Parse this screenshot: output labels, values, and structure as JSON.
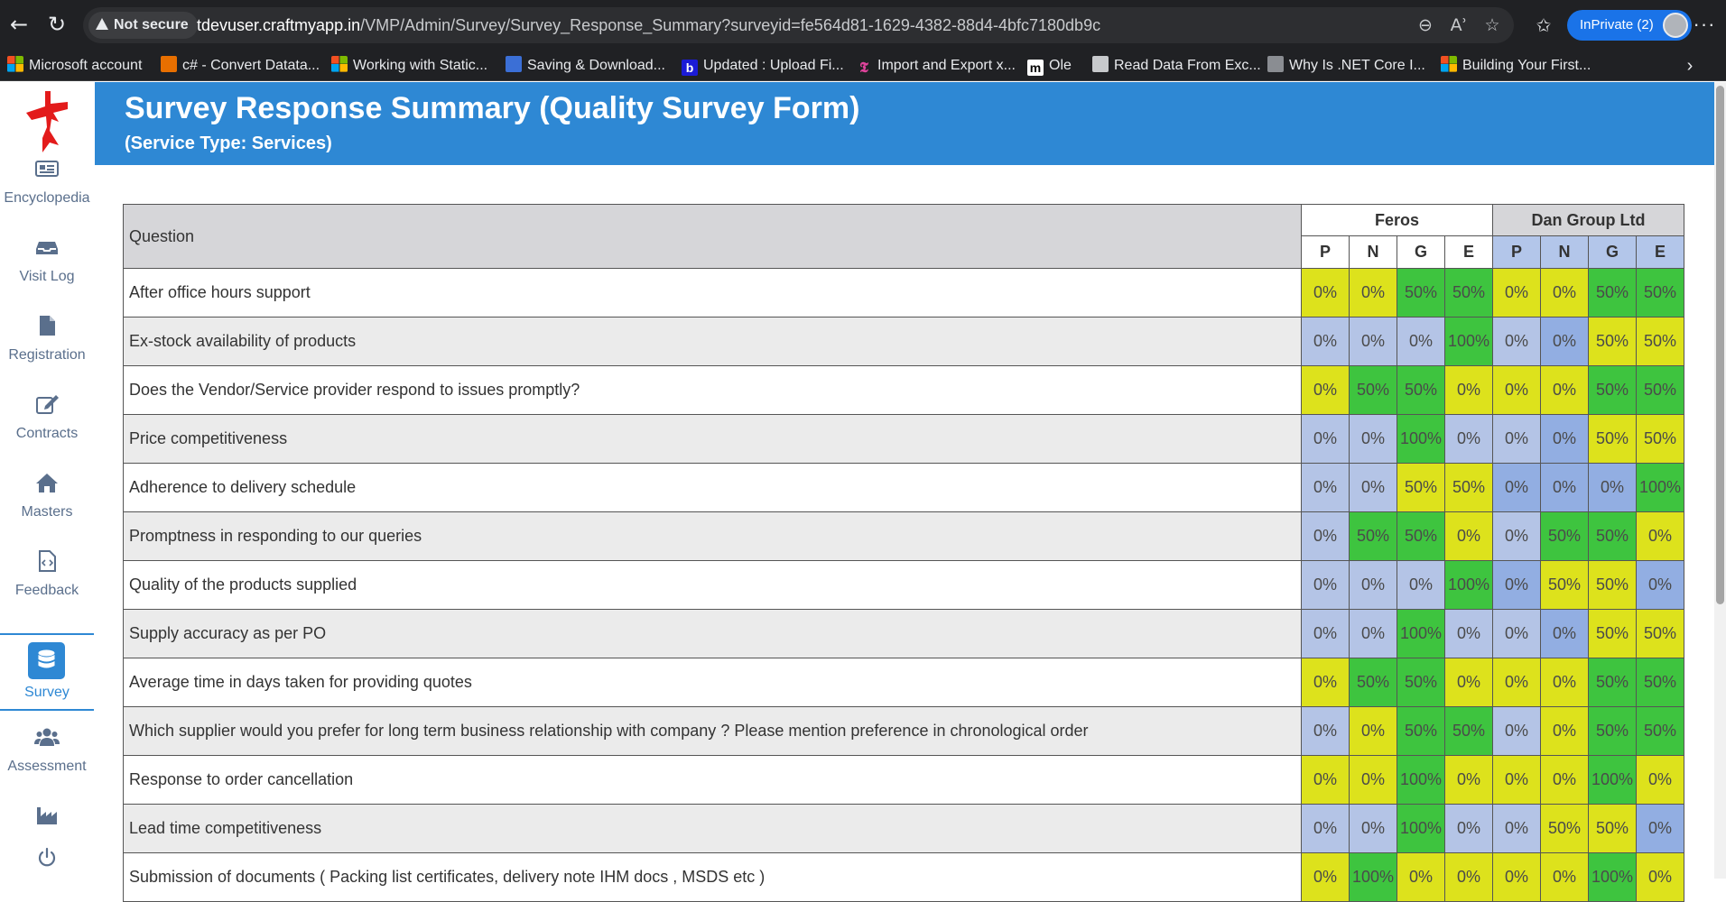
{
  "browser": {
    "not_secure": "Not secure",
    "url_host": "tdevuser.craftmyapp.in",
    "url_path": "/VMP/Admin/Survey/Survey_Response_Summary?surveyid=fe564d81-1629-4382-88d4-4bfc7180db9c",
    "inprivate_label": "InPrivate (2)",
    "bookmarks": [
      {
        "label": "Microsoft account",
        "icon": "microsoft-icon"
      },
      {
        "label": "c# - Convert Datata...",
        "icon": "java-icon"
      },
      {
        "label": "Working with Static...",
        "icon": "microsoft-icon"
      },
      {
        "label": "Saving & Download...",
        "icon": "hd-icon"
      },
      {
        "label": "Updated : Upload Fi...",
        "icon": "b-icon"
      },
      {
        "label": "Import and Export x...",
        "icon": "tb-icon"
      },
      {
        "label": "Ole",
        "icon": "m-icon"
      },
      {
        "label": "Read Data From Exc...",
        "icon": "figure-icon"
      },
      {
        "label": "Why Is .NET Core I...",
        "icon": "net-icon"
      },
      {
        "label": "Building Your First...",
        "icon": "microsoft-icon"
      }
    ]
  },
  "sidebar": {
    "items": [
      {
        "label": "Encyclopedia",
        "icon": "newspaper-icon",
        "active": false
      },
      {
        "label": "Visit Log",
        "icon": "inbox-icon",
        "active": false
      },
      {
        "label": "Registration",
        "icon": "file-icon",
        "active": false
      },
      {
        "label": "Contracts",
        "icon": "edit-icon",
        "active": false
      },
      {
        "label": "Masters",
        "icon": "home-icon",
        "active": false
      },
      {
        "label": "Feedback",
        "icon": "file-code-icon",
        "active": false
      },
      {
        "label": "Survey",
        "icon": "database-icon",
        "active": true
      },
      {
        "label": "Assessment",
        "icon": "users-icon",
        "active": false
      },
      {
        "label": "",
        "icon": "industry-icon",
        "active": false
      }
    ],
    "power_icon": "power-icon"
  },
  "header": {
    "title": "Survey Response Summary (Quality Survey Form)",
    "subtitle": "(Service Type: Services)"
  },
  "colors": {
    "accent": "#2e88d4",
    "P_or_zero_yellow": "#dde21c",
    "green": "#3ec43f",
    "light_blue": "#b4c4e6",
    "mid_blue": "#92aee2"
  },
  "table": {
    "question_header": "Question",
    "vendors": [
      "Feros",
      "Dan Group Ltd"
    ],
    "ratings": [
      "P",
      "N",
      "G",
      "E"
    ],
    "rows": [
      {
        "question": "After office hours support",
        "values": [
          "0%",
          "0%",
          "50%",
          "50%",
          "0%",
          "0%",
          "50%",
          "50%"
        ],
        "colors": [
          "y",
          "y",
          "g",
          "g",
          "y",
          "y",
          "g",
          "g"
        ]
      },
      {
        "question": "Ex-stock availability of products",
        "values": [
          "0%",
          "0%",
          "0%",
          "100%",
          "0%",
          "0%",
          "50%",
          "50%"
        ],
        "colors": [
          "lb",
          "lb",
          "lb",
          "g",
          "lb",
          "mb",
          "y",
          "y"
        ]
      },
      {
        "question": "Does the Vendor/Service provider respond to issues promptly?",
        "values": [
          "0%",
          "50%",
          "50%",
          "0%",
          "0%",
          "0%",
          "50%",
          "50%"
        ],
        "colors": [
          "y",
          "g",
          "g",
          "y",
          "y",
          "y",
          "g",
          "g"
        ]
      },
      {
        "question": "Price competitiveness",
        "values": [
          "0%",
          "0%",
          "100%",
          "0%",
          "0%",
          "0%",
          "50%",
          "50%"
        ],
        "colors": [
          "lb",
          "lb",
          "g",
          "lb",
          "lb",
          "mb",
          "y",
          "y"
        ]
      },
      {
        "question": "Adherence to delivery schedule",
        "values": [
          "0%",
          "0%",
          "50%",
          "50%",
          "0%",
          "0%",
          "0%",
          "100%"
        ],
        "colors": [
          "lb",
          "lb",
          "y",
          "y",
          "mb",
          "mb",
          "mb",
          "g"
        ]
      },
      {
        "question": "Promptness in responding to our queries",
        "values": [
          "0%",
          "50%",
          "50%",
          "0%",
          "0%",
          "50%",
          "50%",
          "0%"
        ],
        "colors": [
          "lb",
          "g",
          "g",
          "y",
          "lb",
          "g",
          "g",
          "y"
        ]
      },
      {
        "question": "Quality of the products supplied",
        "values": [
          "0%",
          "0%",
          "0%",
          "100%",
          "0%",
          "50%",
          "50%",
          "0%"
        ],
        "colors": [
          "lb",
          "lb",
          "lb",
          "g",
          "mb",
          "y",
          "y",
          "mb"
        ]
      },
      {
        "question": "Supply accuracy as per PO",
        "values": [
          "0%",
          "0%",
          "100%",
          "0%",
          "0%",
          "0%",
          "50%",
          "50%"
        ],
        "colors": [
          "lb",
          "lb",
          "g",
          "lb",
          "lb",
          "mb",
          "y",
          "y"
        ]
      },
      {
        "question": "Average time in days taken for providing quotes",
        "values": [
          "0%",
          "50%",
          "50%",
          "0%",
          "0%",
          "0%",
          "50%",
          "50%"
        ],
        "colors": [
          "y",
          "g",
          "g",
          "y",
          "y",
          "y",
          "g",
          "g"
        ]
      },
      {
        "question": "Which supplier would you prefer for long term business relationship with company ? Please mention preference in chronological order",
        "values": [
          "0%",
          "0%",
          "50%",
          "50%",
          "0%",
          "0%",
          "50%",
          "50%"
        ],
        "colors": [
          "lb",
          "y",
          "g",
          "g",
          "lb",
          "y",
          "g",
          "g"
        ]
      },
      {
        "question": "Response to order cancellation",
        "values": [
          "0%",
          "0%",
          "100%",
          "0%",
          "0%",
          "0%",
          "100%",
          "0%"
        ],
        "colors": [
          "y",
          "y",
          "g",
          "y",
          "y",
          "y",
          "g",
          "y"
        ]
      },
      {
        "question": "Lead time competitiveness",
        "values": [
          "0%",
          "0%",
          "100%",
          "0%",
          "0%",
          "50%",
          "50%",
          "0%"
        ],
        "colors": [
          "lb",
          "lb",
          "g",
          "lb",
          "lb",
          "y",
          "y",
          "mb"
        ]
      },
      {
        "question": "Submission of documents ( Packing list certificates, delivery note IHM docs , MSDS etc )",
        "values": [
          "0%",
          "100%",
          "0%",
          "0%",
          "0%",
          "0%",
          "100%",
          "0%"
        ],
        "colors": [
          "y",
          "g",
          "y",
          "y",
          "y",
          "y",
          "g",
          "y"
        ]
      }
    ]
  }
}
